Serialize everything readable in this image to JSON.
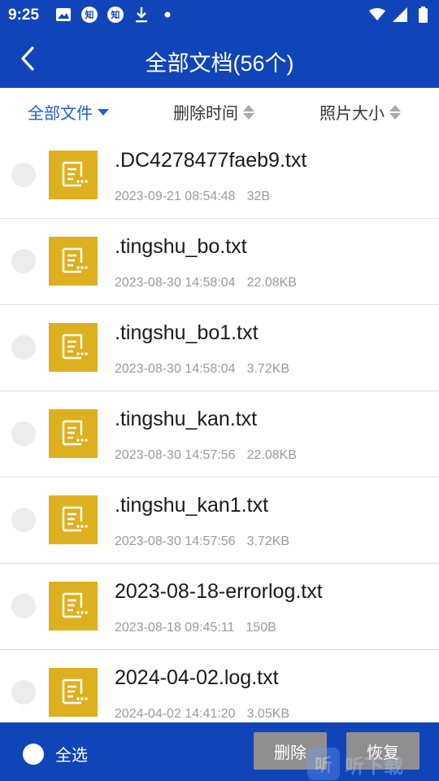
{
  "status_bar": {
    "time": "9:25",
    "icons_left": [
      "image-icon",
      "zhihu-icon",
      "zhihu-icon",
      "download-icon",
      "dot-icon"
    ],
    "zhihu_label": "知",
    "icons_right": [
      "wifi-icon",
      "signal-icon",
      "battery-icon"
    ]
  },
  "app_bar": {
    "title": "全部文档(56个)",
    "back_icon": "back-arrow-icon"
  },
  "filters": {
    "all_files": "全部文件",
    "delete_time": "删除时间",
    "photo_size": "照片大小"
  },
  "files": [
    {
      "name": ".DC4278477faeb9.txt",
      "date": "2023-09-21 08:54:48",
      "size": "32B"
    },
    {
      "name": ".tingshu_bo.txt",
      "date": "2023-08-30 14:58:04",
      "size": "22.08KB"
    },
    {
      "name": ".tingshu_bo1.txt",
      "date": "2023-08-30 14:58:04",
      "size": "3.72KB"
    },
    {
      "name": ".tingshu_kan.txt",
      "date": "2023-08-30 14:57:56",
      "size": "22.08KB"
    },
    {
      "name": ".tingshu_kan1.txt",
      "date": "2023-08-30 14:57:56",
      "size": "3.72KB"
    },
    {
      "name": "2023-08-18-errorlog.txt",
      "date": "2023-08-18 09:45:11",
      "size": "150B"
    },
    {
      "name": "2024-04-02.log.txt",
      "date": "2024-04-02 14:41:20",
      "size": "3.05KB"
    }
  ],
  "bottom_bar": {
    "select_all": "全选",
    "delete": "删除",
    "restore": "恢复",
    "watermark_badge": "听",
    "watermark_text": "听下载"
  },
  "colors": {
    "primary": "#0f45b8",
    "accent": "#1f5fd6",
    "file_icon": "#deb020",
    "button_gray": "#8f8f8f"
  }
}
